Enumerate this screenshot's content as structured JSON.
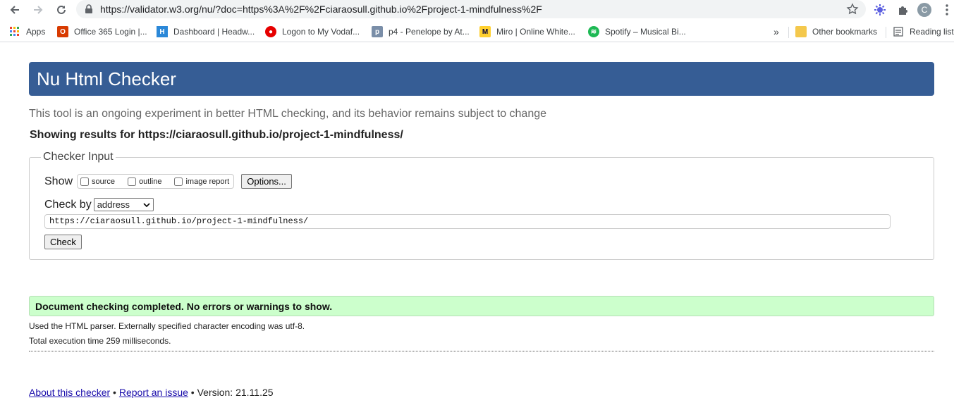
{
  "browser": {
    "url": "https://validator.w3.org/nu/?doc=https%3A%2F%2Fciaraosull.github.io%2Fproject-1-mindfulness%2F",
    "profile_initial": "C",
    "bookmarks": [
      {
        "label": "Apps",
        "icon": "apps-grid-icon"
      },
      {
        "label": "Office 365 Login |...",
        "icon": "office-icon"
      },
      {
        "label": "Dashboard | Headw...",
        "icon": "headway-icon"
      },
      {
        "label": "Logon to My Vodaf...",
        "icon": "vodafone-icon"
      },
      {
        "label": "p4 - Penelope by At...",
        "icon": "penelope-icon"
      },
      {
        "label": "Miro | Online White...",
        "icon": "miro-icon"
      },
      {
        "label": "Spotify – Musical Bi...",
        "icon": "spotify-icon"
      }
    ],
    "overflow_label": "»",
    "other_bookmarks": "Other bookmarks",
    "reading_list": "Reading list"
  },
  "page": {
    "title": "Nu Html Checker",
    "intro": "This tool is an ongoing experiment in better HTML checking, and its behavior remains subject to change",
    "showing": "Showing results for https://ciaraosull.github.io/project-1-mindfulness/",
    "checker": {
      "legend": "Checker Input",
      "show_label": "Show",
      "options": [
        "source",
        "outline",
        "image report"
      ],
      "options_button": "Options...",
      "check_by_label": "Check by",
      "check_by_value": "address",
      "url_value": "https://ciaraosull.github.io/project-1-mindfulness/",
      "check_button": "Check"
    },
    "result": {
      "message": "Document checking completed. No errors or warnings to show.",
      "parser": "Used the HTML parser. Externally specified character encoding was utf-8.",
      "time": "Total execution time 259 milliseconds."
    },
    "footer": {
      "about": "About this checker",
      "sep1": " • ",
      "report": "Report an issue",
      "version": " • Version: 21.11.25"
    }
  }
}
